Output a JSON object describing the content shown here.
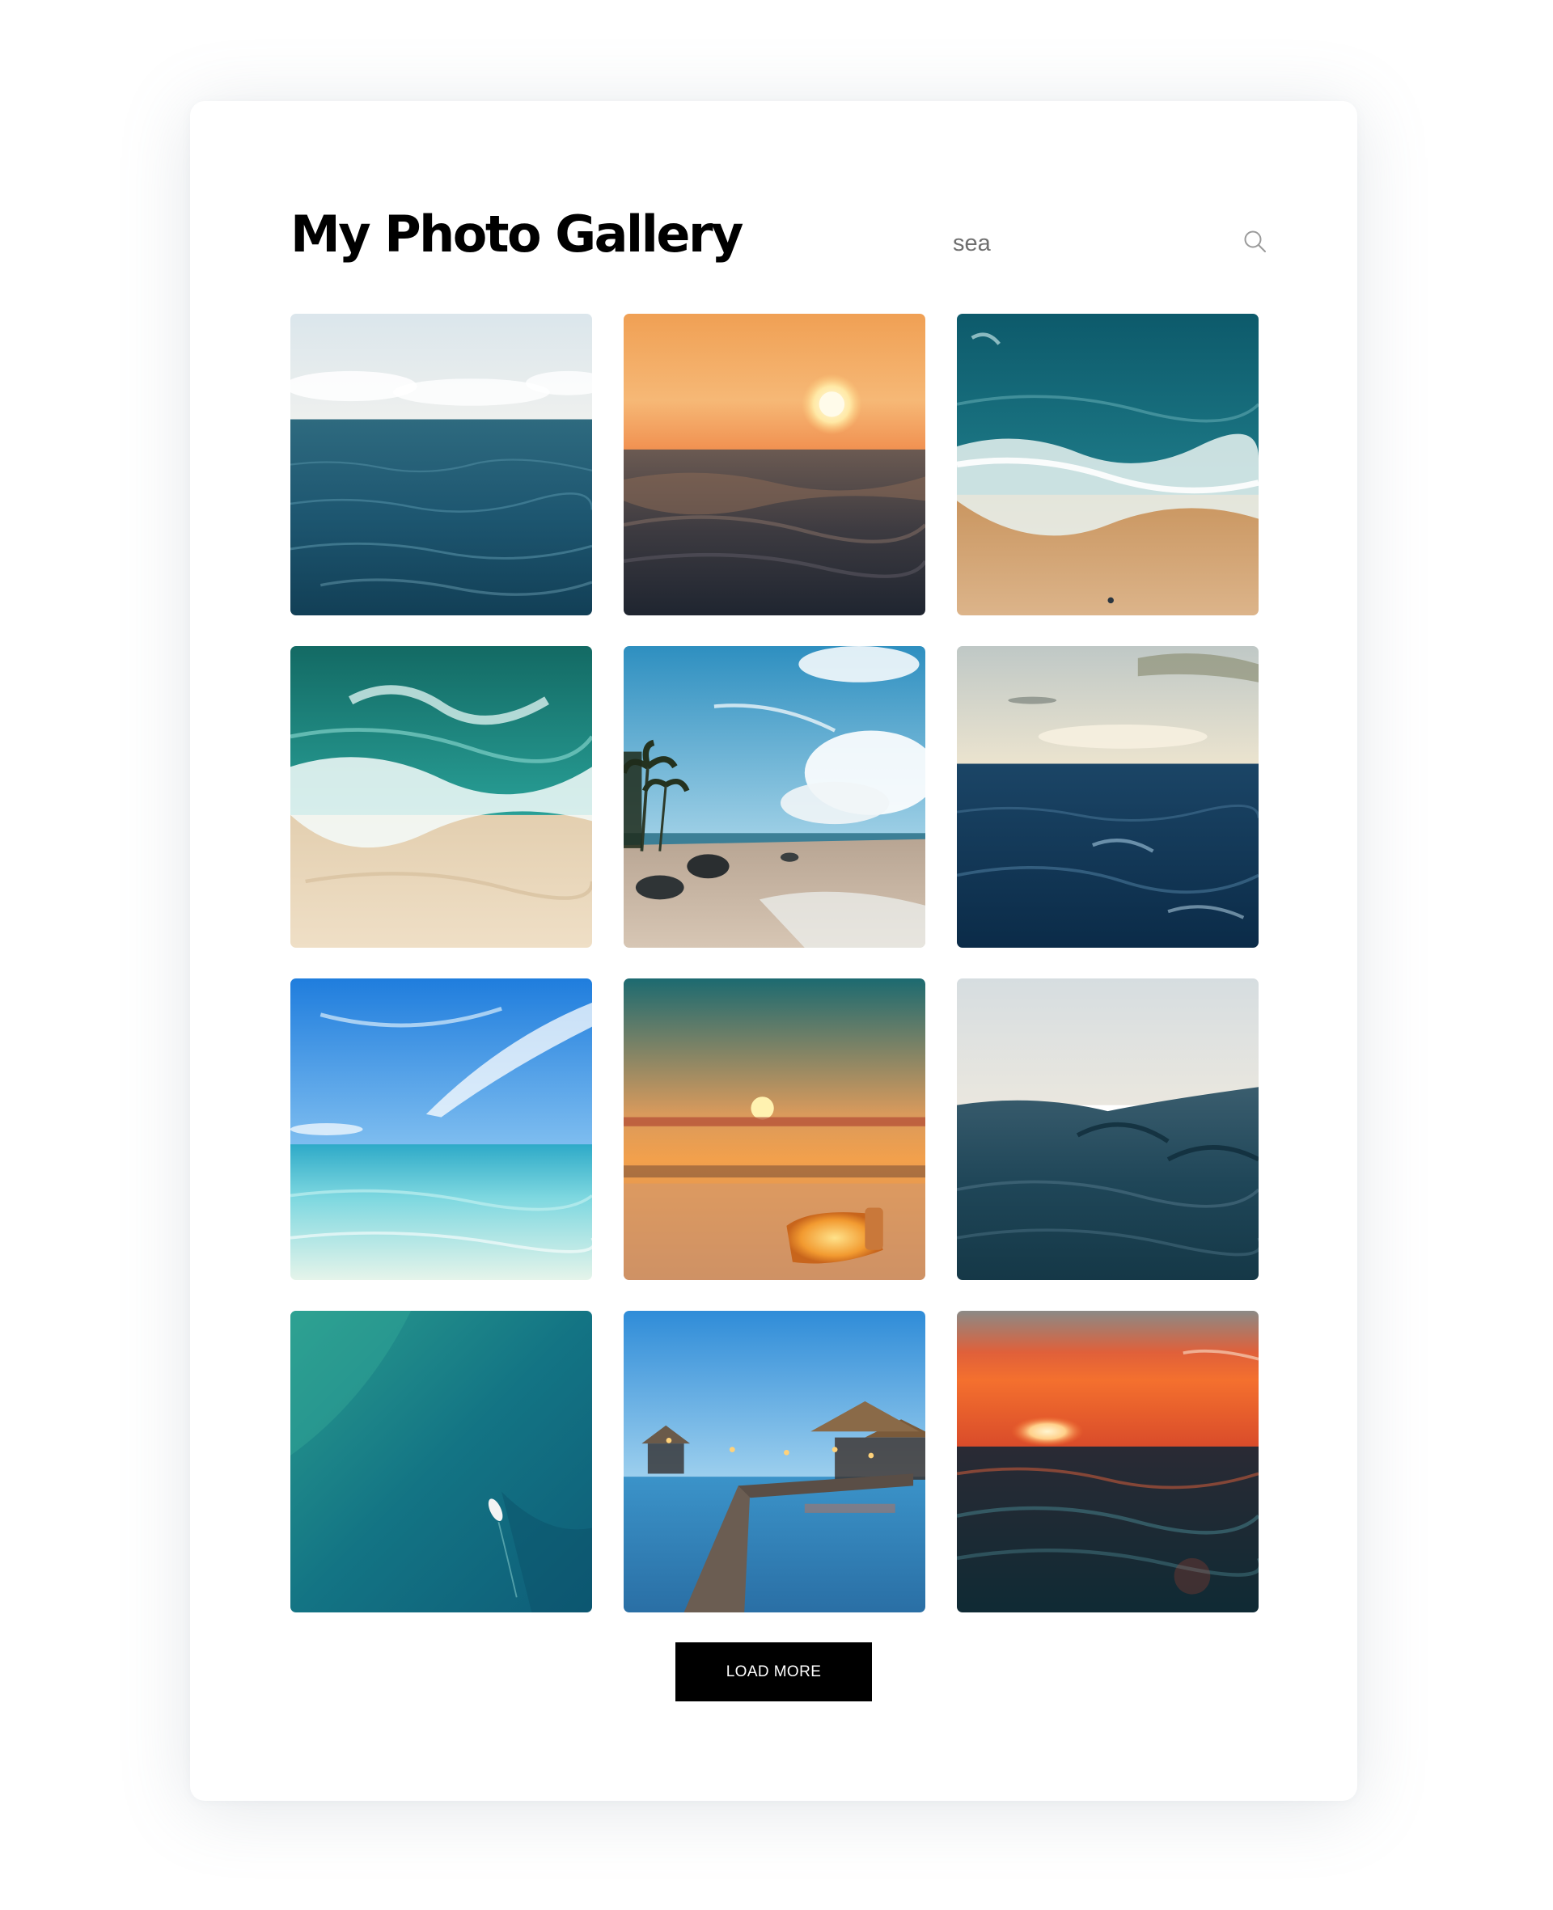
{
  "header": {
    "title": "My Photo Gallery"
  },
  "search": {
    "value": "sea",
    "icon": "search-icon"
  },
  "gallery": {
    "photos": [
      {
        "subject": "open ocean under a pale cloudy sky"
      },
      {
        "subject": "sunset over a close-up wave"
      },
      {
        "subject": "aerial view of waves breaking on a sandy beach"
      },
      {
        "subject": "aerial view of turquoise surf on a beach"
      },
      {
        "subject": "tropical beach with palm trees and rocks"
      },
      {
        "subject": "deep blue sea under an evening sky"
      },
      {
        "subject": "clear turquoise shallow water under a blue sky"
      },
      {
        "subject": "glowing jar on the beach at sunset"
      },
      {
        "subject": "dark calm sea surface at water level"
      },
      {
        "subject": "aerial view of a small boat on teal water"
      },
      {
        "subject": "wooden pier to a lit beach hut at dusk"
      },
      {
        "subject": "red sunset over dark waves"
      }
    ]
  },
  "actions": {
    "load_more_label": "LOAD MORE"
  },
  "colors": {
    "title": "#000000",
    "button_background": "#000000",
    "button_text": "#ffffff",
    "search_text": "#6f6f6f",
    "icon": "#9a9a9a"
  }
}
